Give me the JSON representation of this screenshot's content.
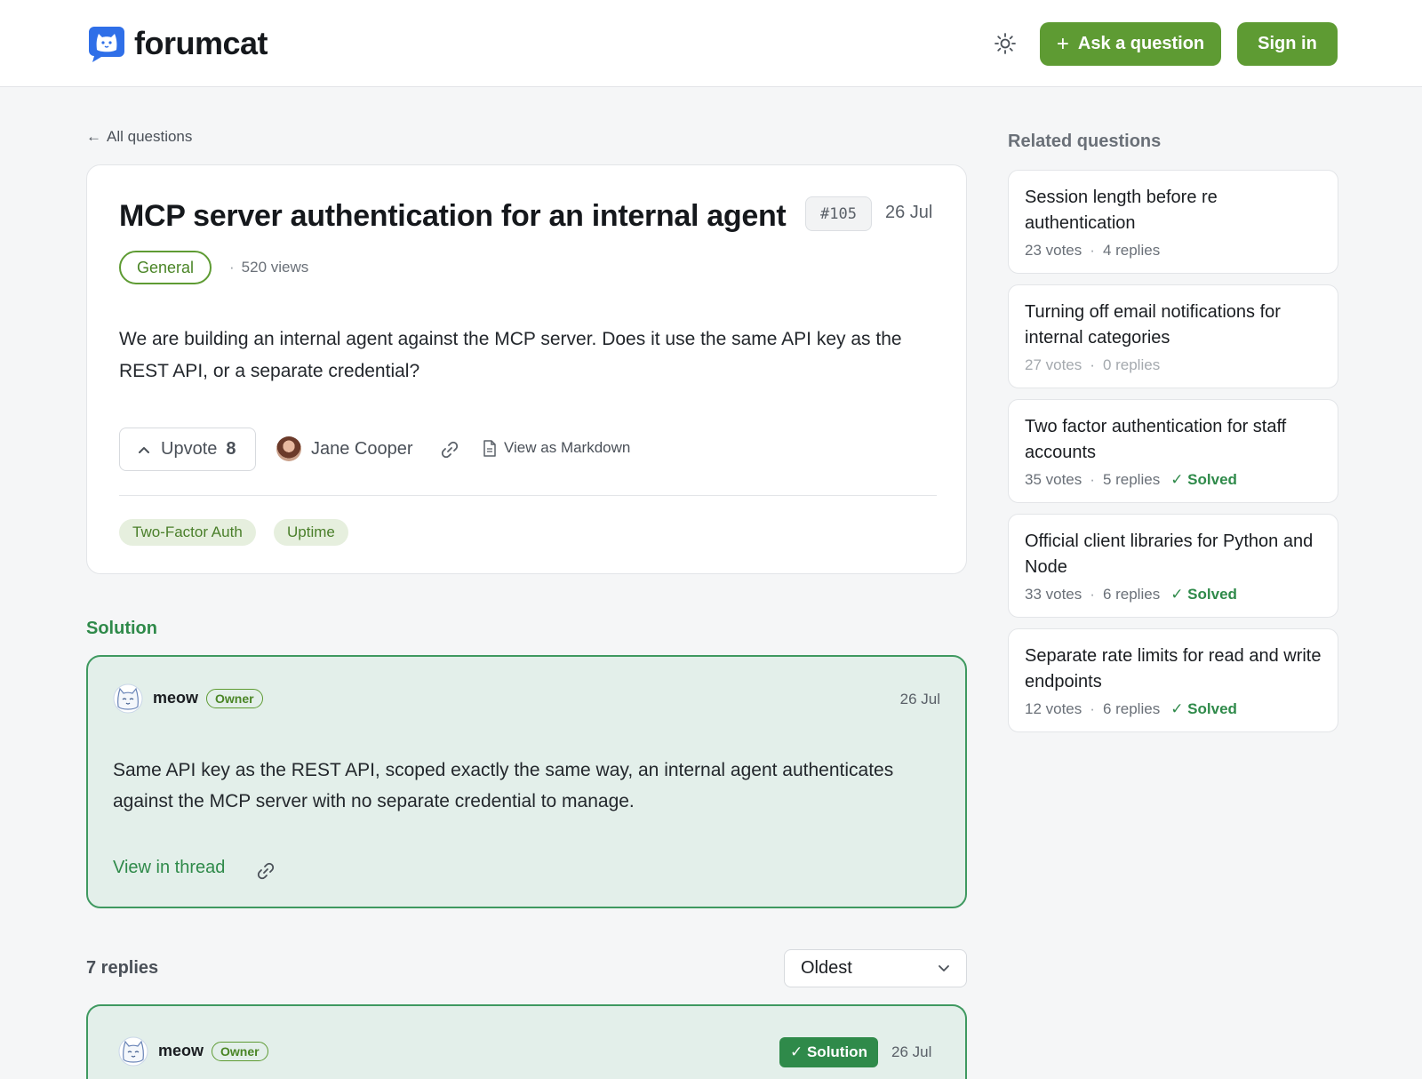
{
  "header": {
    "brand": "forumcat",
    "ask_label": "Ask a question",
    "signin_label": "Sign in"
  },
  "back_label": "All questions",
  "question": {
    "title": "MCP server authentication for an internal agent",
    "number": "#105",
    "date": "26 Jul",
    "category": "General",
    "views": "520 views",
    "body": "We are building an internal agent against the MCP server. Does it use the same API key as the REST API, or a separate credential?",
    "upvote_label": "Upvote",
    "upvote_count": "8",
    "author": "Jane Cooper",
    "markdown_label": "View as Markdown",
    "tags": [
      "Two-Factor Auth",
      "Uptime"
    ]
  },
  "solution": {
    "heading": "Solution",
    "author": "meow",
    "role": "Owner",
    "date": "26 Jul",
    "body": "Same API key as the REST API, scoped exactly the same way, an internal agent authenticates against the MCP server with no separate credential to manage.",
    "view_label": "View in thread"
  },
  "replies": {
    "count_label": "7 replies",
    "sort_value": "Oldest",
    "first": {
      "author": "meow",
      "role": "Owner",
      "badge": "✓ Solution",
      "date": "26 Jul"
    }
  },
  "sidebar": {
    "heading": "Related questions",
    "items": [
      {
        "title": "Session length before re authentication",
        "votes": "23 votes",
        "replies": "4 replies",
        "solved": ""
      },
      {
        "title": "Turning off email notifications for internal categories",
        "votes": "27 votes",
        "replies": "0 replies",
        "solved": ""
      },
      {
        "title": "Two factor authentication for staff accounts",
        "votes": "35 votes",
        "replies": "5 replies",
        "solved": "✓ Solved"
      },
      {
        "title": "Official client libraries for Python and Node",
        "votes": "33 votes",
        "replies": "6 replies",
        "solved": "✓ Solved"
      },
      {
        "title": "Separate rate limits for read and write endpoints",
        "votes": "12 votes",
        "replies": "6 replies",
        "solved": "✓ Solved"
      }
    ]
  },
  "icons": {
    "logo": "cat-chat-icon",
    "theme": "sun-icon",
    "back": "arrow-left-icon",
    "upvote": "chevron-up-icon",
    "link": "link-icon",
    "markdown": "document-icon",
    "sort": "chevron-down-icon"
  },
  "colors": {
    "brand_green": "#5e9b33",
    "solution_green": "#2f8a4a",
    "solution_bg": "#e3efea",
    "logo_blue": "#2f6fe8"
  }
}
